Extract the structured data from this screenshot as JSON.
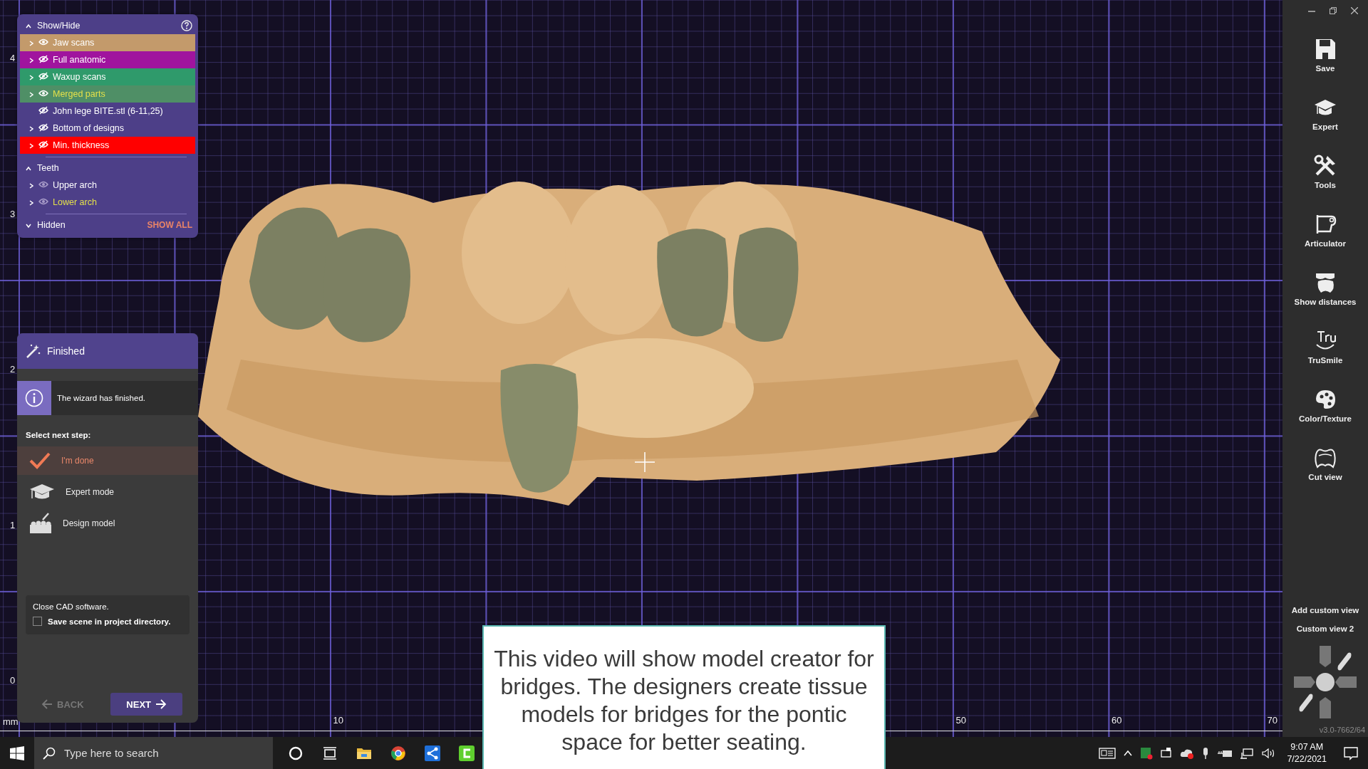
{
  "viewport": {
    "unit": "mm",
    "x_ticks": [
      "10",
      "50",
      "60",
      "70"
    ],
    "y_ticks": [
      "4",
      "3",
      "2",
      "1",
      "0"
    ]
  },
  "show_hide_panel": {
    "sections": [
      {
        "title": "Show/Hide",
        "expanded": true,
        "items": [
          {
            "label": "Jaw scans",
            "visible": true,
            "expandable": true,
            "highlighted": false,
            "color": "#c39a6b"
          },
          {
            "label": "Full anatomic",
            "visible": false,
            "expandable": true,
            "highlighted": false,
            "color": "#a0149e"
          },
          {
            "label": "Waxup scans",
            "visible": false,
            "expandable": true,
            "highlighted": false,
            "color": "#2f9a6b"
          },
          {
            "label": "Merged parts",
            "visible": true,
            "expandable": true,
            "highlighted": true,
            "color": "#4f8f66"
          },
          {
            "label": "John lege BITE.stl (6-11,25)",
            "visible": false,
            "expandable": false,
            "highlighted": false
          },
          {
            "label": "Bottom of designs",
            "visible": false,
            "expandable": true,
            "highlighted": false
          },
          {
            "label": "Min. thickness",
            "visible": false,
            "expandable": true,
            "highlighted": false,
            "color": "#ff0000"
          }
        ]
      },
      {
        "title": "Teeth",
        "expanded": true,
        "items": [
          {
            "label": "Upper arch",
            "visible": true,
            "expandable": true,
            "highlighted": false
          },
          {
            "label": "Lower arch",
            "visible": true,
            "expandable": true,
            "highlighted": true
          }
        ]
      },
      {
        "title": "Hidden",
        "expanded": false,
        "action": "SHOW ALL"
      }
    ]
  },
  "wizard": {
    "title": "Finished",
    "message": "The wizard has finished.",
    "prompt": "Select next step:",
    "options": [
      {
        "label": "I'm done",
        "kind": "done",
        "selected": true
      },
      {
        "label": "Expert mode",
        "kind": "expert",
        "selected": false
      },
      {
        "label": "Design model",
        "kind": "design",
        "selected": false
      }
    ],
    "note": "Close CAD software.",
    "checkbox": {
      "label": "Save scene in project directory.",
      "checked": false
    },
    "buttons": [
      {
        "label": "BACK",
        "kind": "back",
        "disabled": true
      },
      {
        "label": "NEXT",
        "kind": "next",
        "disabled": false
      }
    ]
  },
  "toolbar": {
    "tools": [
      {
        "label": "Save",
        "kind": "save"
      },
      {
        "label": "Expert",
        "kind": "expert"
      },
      {
        "label": "Tools",
        "kind": "tools"
      },
      {
        "label": "Articulator",
        "kind": "articulator"
      },
      {
        "label": "Show distances",
        "kind": "distances"
      },
      {
        "label": "TruSmile",
        "kind": "trusmile"
      },
      {
        "label": "Color/Texture",
        "kind": "color"
      },
      {
        "label": "Cut view",
        "kind": "cut"
      }
    ],
    "custom_views": [
      "Add custom view",
      "Custom view 2"
    ],
    "version": "v3.0-7662/64"
  },
  "caption": "This video will show model creator for bridges. The designers create tissue models for bridges for the pontic space for better seating.",
  "taskbar": {
    "search": {
      "placeholder": "Type here to search"
    },
    "apps": [
      {
        "kind": "cortana"
      },
      {
        "kind": "task-view"
      },
      {
        "kind": "folder"
      },
      {
        "kind": "browser"
      },
      {
        "kind": "remote"
      },
      {
        "kind": "editor"
      }
    ],
    "tray": [
      {
        "kind": "news"
      },
      {
        "kind": "chevron"
      },
      {
        "kind": "spreadsheet"
      },
      {
        "kind": "network-lock"
      },
      {
        "kind": "cloud"
      },
      {
        "kind": "microphone"
      },
      {
        "kind": "power"
      },
      {
        "kind": "network"
      },
      {
        "kind": "volume"
      }
    ],
    "time": "9:07 AM",
    "date": "7/22/2021"
  }
}
